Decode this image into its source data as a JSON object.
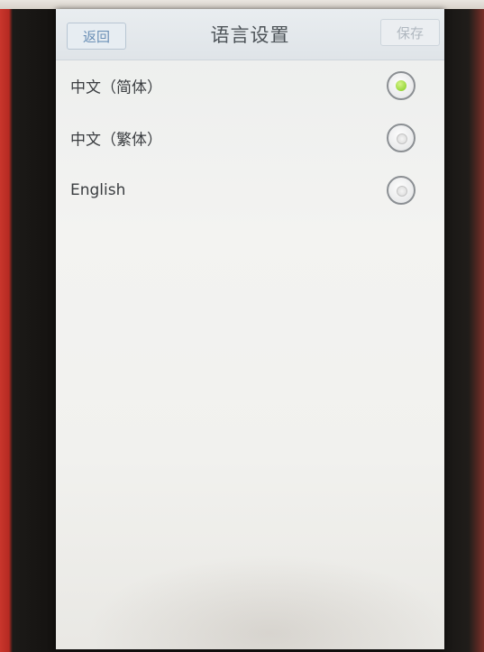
{
  "header": {
    "back_label": "返回",
    "title": "语言设置",
    "save_label": "保存"
  },
  "languages": [
    {
      "label": "中文（简体）",
      "selected": true
    },
    {
      "label": "中文（繁体）",
      "selected": false
    },
    {
      "label": "English",
      "selected": false
    }
  ],
  "colors": {
    "selected_radio": "#7fcb1c",
    "back_text": "#6a8fb6"
  }
}
